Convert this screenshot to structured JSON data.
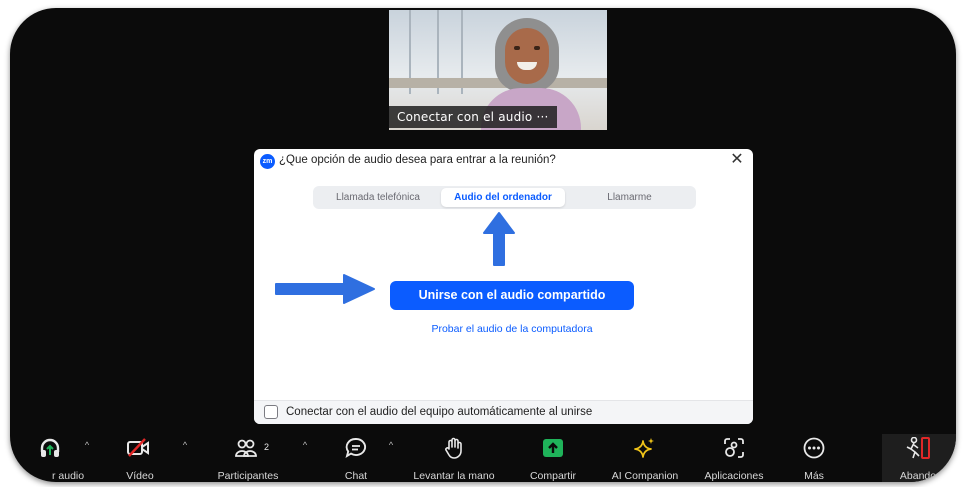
{
  "video": {
    "label": "Conectar con el audio ···"
  },
  "dialog": {
    "logo": "zm",
    "title": "¿Que opción de audio desea para entrar a la reunión?",
    "close": "✕",
    "tabs": [
      "Llamada telefónica",
      "Audio del ordenador",
      "Llamarme"
    ],
    "join_button": "Unirse con el audio compartido",
    "test_link": "Probar el audio de la computadora",
    "auto_join_label": "Conectar con el audio del equipo automáticamente al unirse"
  },
  "toolbar": {
    "audio_label": "r audio",
    "video_label": "Vídeo",
    "participants_label": "Participantes",
    "participants_count": "2",
    "chat_label": "Chat",
    "raise_hand_label": "Levantar la mano",
    "share_label": "Compartir",
    "ai_label": "AI Companion",
    "apps_label": "Aplicaciones",
    "more_label": "Más",
    "leave_label": "Abando",
    "caret": "^"
  },
  "colors": {
    "accent": "#0b5cff",
    "arrow": "#2f6fe0",
    "share": "#1fb35a",
    "ai": "#f0c419",
    "leave": "#e02828"
  }
}
